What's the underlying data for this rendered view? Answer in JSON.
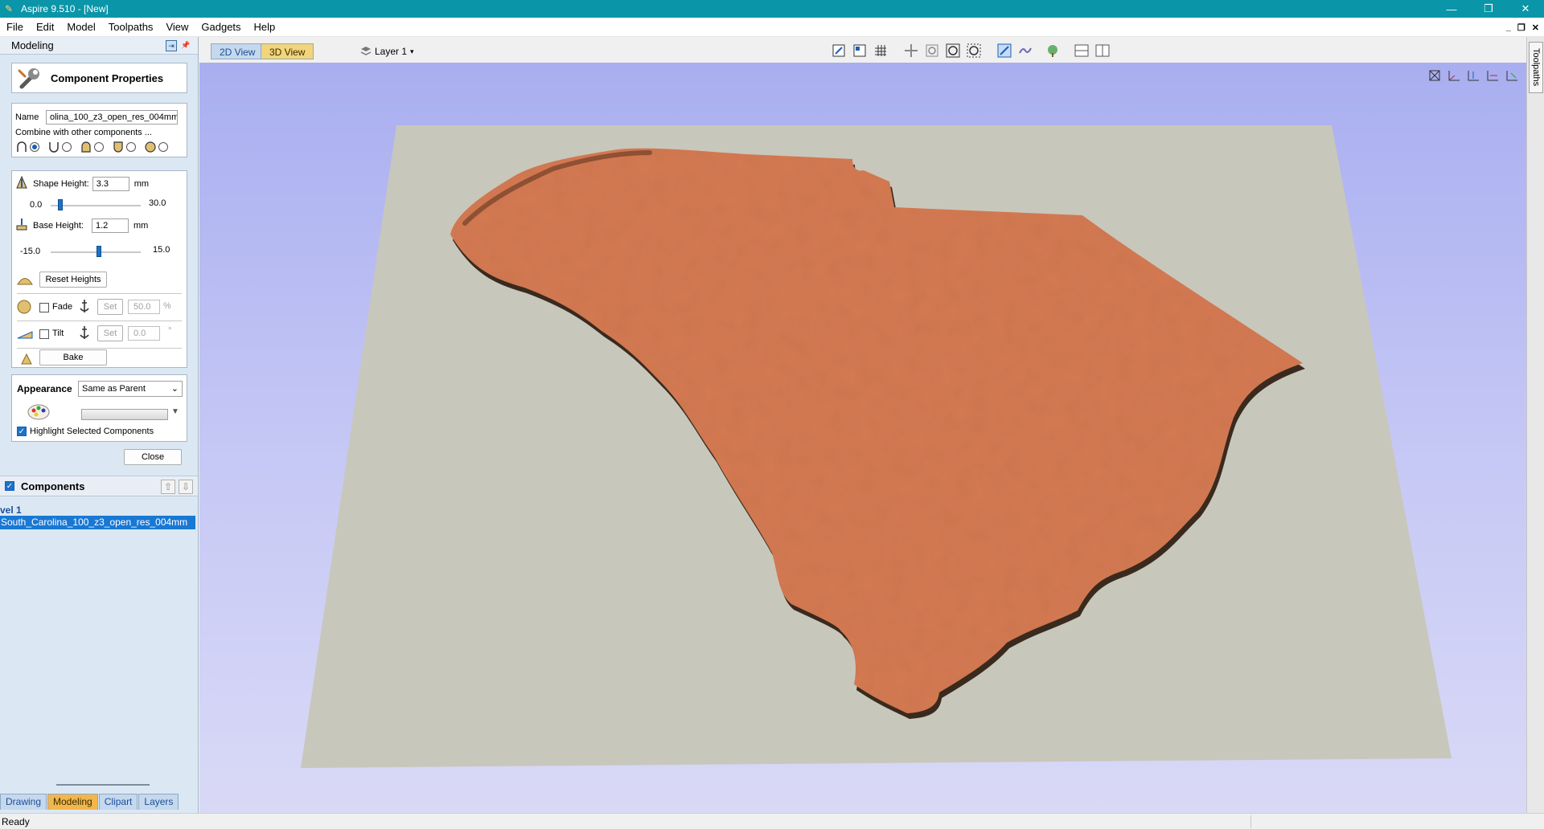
{
  "window": {
    "title": "Aspire 9.510 - [New]",
    "minimize": "—",
    "maximize": "❐",
    "close": "✕"
  },
  "menu": [
    "File",
    "Edit",
    "Model",
    "Toolpaths",
    "View",
    "Gadgets",
    "Help"
  ],
  "mdi": {
    "minimize": "_",
    "restore": "❐",
    "close": "✕"
  },
  "left_panel": {
    "title": "Modeling",
    "component_properties": {
      "title": "Component Properties",
      "name_label": "Name",
      "name_value": "olina_100_z3_open_res_004mm",
      "combine_label": "Combine with other components ..."
    },
    "shape_height": {
      "label": "Shape Height:",
      "value": "3.3",
      "unit": "mm",
      "min": "0.0",
      "max": "30.0",
      "level": 0.11
    },
    "base_height": {
      "label": "Base Height:",
      "value": "1.2",
      "unit": "mm",
      "min": "-15.0",
      "max": "15.0",
      "level": 0.54
    },
    "reset_heights": "Reset Heights",
    "fade": {
      "label": "Fade",
      "set": "Set",
      "value": "50.0",
      "unit": "%"
    },
    "tilt": {
      "label": "Tilt",
      "set": "Set",
      "value": "0.0",
      "unit": "°"
    },
    "bake": "Bake",
    "appearance": {
      "label": "Appearance",
      "value": "Same as Parent"
    },
    "highlight_label": "Highlight Selected Components",
    "close": "Close",
    "components": {
      "title": "Components",
      "level_label": "vel 1",
      "items": [
        "South_Carolina_100_z3_open_res_004mm"
      ]
    },
    "tabs": [
      "Drawing",
      "Modeling",
      "Clipart",
      "Layers"
    ],
    "active_tab": "Modeling"
  },
  "view_tabs": [
    "2D View",
    "3D View"
  ],
  "active_view": "3D View",
  "layer": "Layer 1",
  "right_strip": {
    "toolpaths_tab": "Toolpaths"
  },
  "status": "Ready",
  "colors": {
    "title_bar": "#0a95a8",
    "model": "#d47a52",
    "plane": "#c8c7bb",
    "active_tab": "#f2b64b",
    "selection": "#1978d4"
  }
}
